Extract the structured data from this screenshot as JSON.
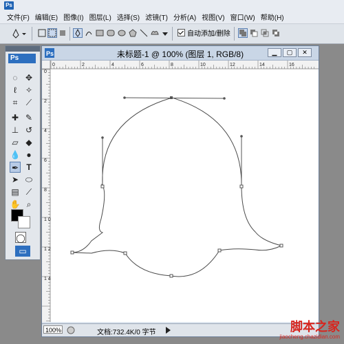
{
  "app": {
    "logo": "Ps"
  },
  "menu": [
    {
      "label": "文件(F)"
    },
    {
      "label": "编辑(E)"
    },
    {
      "label": "图像(I)"
    },
    {
      "label": "图层(L)"
    },
    {
      "label": "选择(S)"
    },
    {
      "label": "滤镜(T)"
    },
    {
      "label": "分析(A)"
    },
    {
      "label": "视图(V)"
    },
    {
      "label": "窗口(W)"
    },
    {
      "label": "帮助(H)"
    }
  ],
  "options": {
    "auto_add_delete_label": "自动添加/删除",
    "auto_add_delete_checked": true
  },
  "toolbox": {
    "badge": "Ps",
    "fg_color": "#000000",
    "bg_color": "#ffffff"
  },
  "document": {
    "title": "未标题-1 @ 100% (图层 1, RGB/8)",
    "zoom": "100%",
    "status": "文档:732.4K/0 字节",
    "ruler_h": [
      "0",
      "2",
      "4",
      "6",
      "8",
      "10",
      "12",
      "14",
      "16"
    ],
    "ruler_v": [
      "0",
      "2",
      "4",
      "6",
      "8",
      "1\n0",
      "1\n2",
      "1\n4"
    ]
  },
  "watermark": {
    "line1": "脚本之家",
    "line2": "jiaocheng.chazidian.com"
  },
  "colors": {
    "accent": "#1f63b4",
    "path": "#4a4a4a"
  }
}
